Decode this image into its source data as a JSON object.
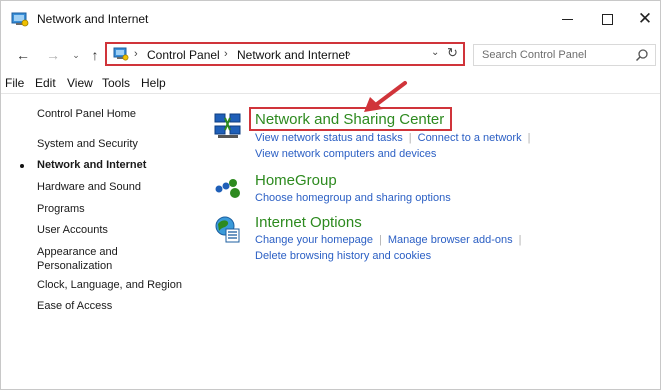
{
  "window": {
    "title": "Network and Internet",
    "controls": {
      "minimize": "minimize",
      "maximize": "maximize",
      "close": "close"
    }
  },
  "nav": {
    "back_glyph": "←",
    "forward_glyph": "→",
    "recent_glyph": "⌄",
    "up_glyph": "↑"
  },
  "address": {
    "separator": "›",
    "crumbs": [
      "Control Panel",
      "Network and Internet"
    ],
    "dropdown_glyph": "⌄",
    "refresh_glyph": "↻"
  },
  "search": {
    "placeholder": "Search Control Panel",
    "icon": "search-icon"
  },
  "menu": {
    "items": [
      "File",
      "Edit",
      "View",
      "Tools",
      "Help"
    ]
  },
  "sidebar": {
    "items": [
      {
        "label": "Control Panel Home",
        "active": false
      },
      {
        "label": "System and Security",
        "active": false
      },
      {
        "label": "Network and Internet",
        "active": true
      },
      {
        "label": "Hardware and Sound",
        "active": false
      },
      {
        "label": "Programs",
        "active": false
      },
      {
        "label": "User Accounts",
        "active": false
      },
      {
        "label": "Appearance and Personalization",
        "active": false
      },
      {
        "label": "Clock, Language, and Region",
        "active": false
      },
      {
        "label": "Ease of Access",
        "active": false
      }
    ],
    "appearance_line1": "Appearance and",
    "appearance_line2": "Personalization"
  },
  "categories": [
    {
      "title": "Network and Sharing Center",
      "icon": "network-sharing-icon",
      "links": [
        "View network status and tasks",
        "Connect to a network",
        "View network computers and devices"
      ]
    },
    {
      "title": "HomeGroup",
      "icon": "homegroup-icon",
      "links": [
        "Choose homegroup and sharing options"
      ]
    },
    {
      "title": "Internet Options",
      "icon": "internet-options-icon",
      "links": [
        "Change your homepage",
        "Manage browser add-ons",
        "Delete browsing history and cookies"
      ]
    }
  ],
  "colors": {
    "highlight": "#d0343a",
    "category_title": "#2d8a1f",
    "link": "#2b5fc4"
  }
}
